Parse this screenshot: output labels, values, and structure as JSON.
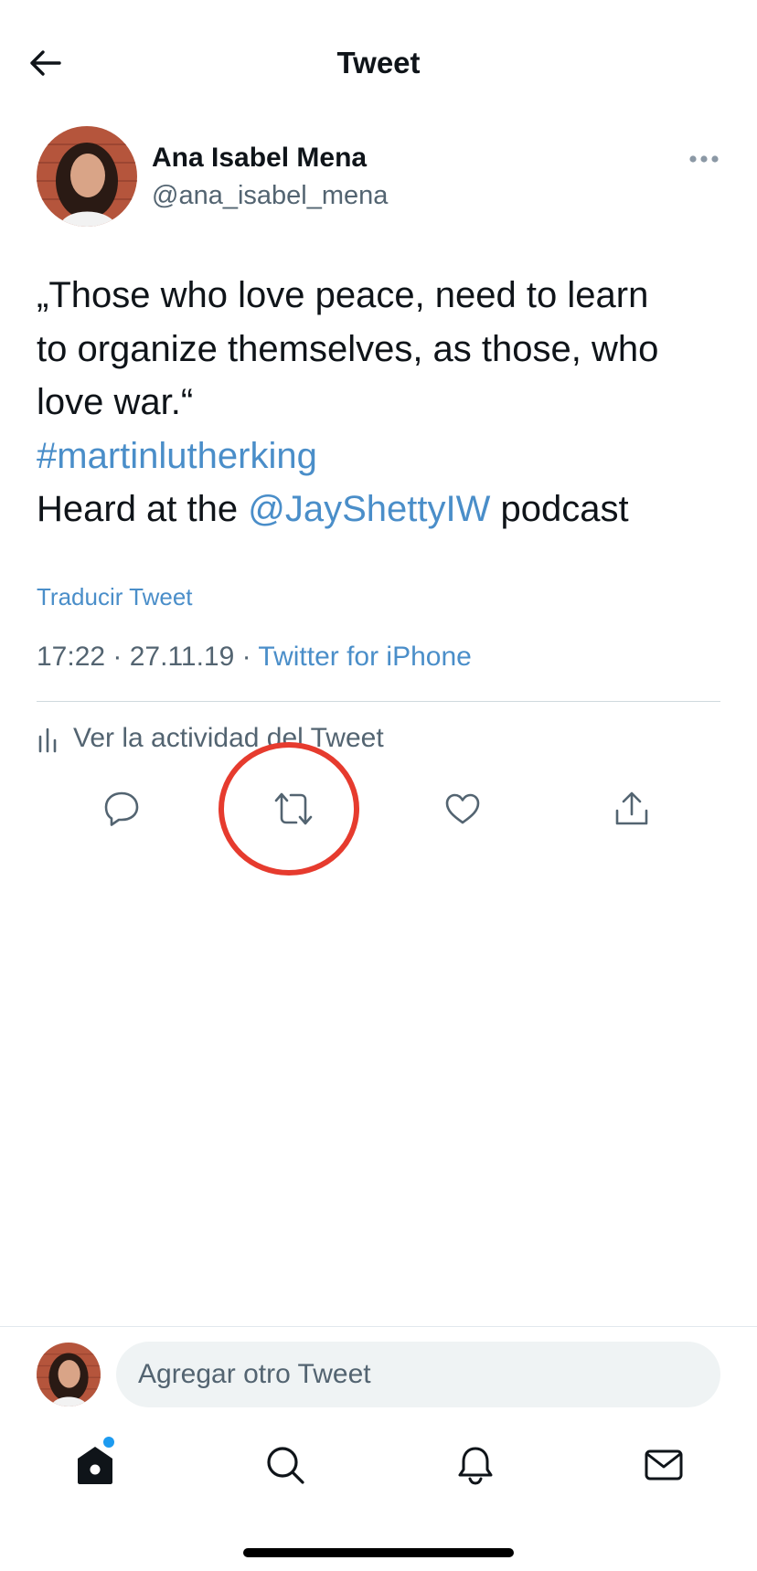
{
  "header": {
    "title": "Tweet"
  },
  "author": {
    "name": "Ana Isabel Mena",
    "handle": "@ana_isabel_mena"
  },
  "tweet": {
    "line1": "„Those who love peace, need to learn",
    "line2": "to organize themselves, as those, who",
    "line3": "love war.“",
    "hashtag": "#martinlutherking",
    "line5_prefix": "Heard at the ",
    "mention": "@JayShettyIW",
    "line5_suffix": " podcast",
    "translate_label": "Traducir Tweet",
    "timestamp": "17:22 · 27.11.19 · ",
    "source": "Twitter for iPhone"
  },
  "activity": {
    "label": "Ver la actividad del Tweet"
  },
  "actions": {
    "reply_icon": "reply-icon",
    "retweet_icon": "retweet-icon",
    "like_icon": "heart-icon",
    "share_icon": "share-icon"
  },
  "composer": {
    "placeholder": "Agregar otro Tweet"
  },
  "bottom_nav": {
    "items": [
      "home-icon",
      "search-icon",
      "bell-icon",
      "mail-icon"
    ],
    "home_has_notification_dot": true
  },
  "colors": {
    "link": "#4a8ec9",
    "secondary_text": "#536471",
    "highlight_ring": "#e63b2e",
    "notification_dot": "#1d9bf0"
  }
}
